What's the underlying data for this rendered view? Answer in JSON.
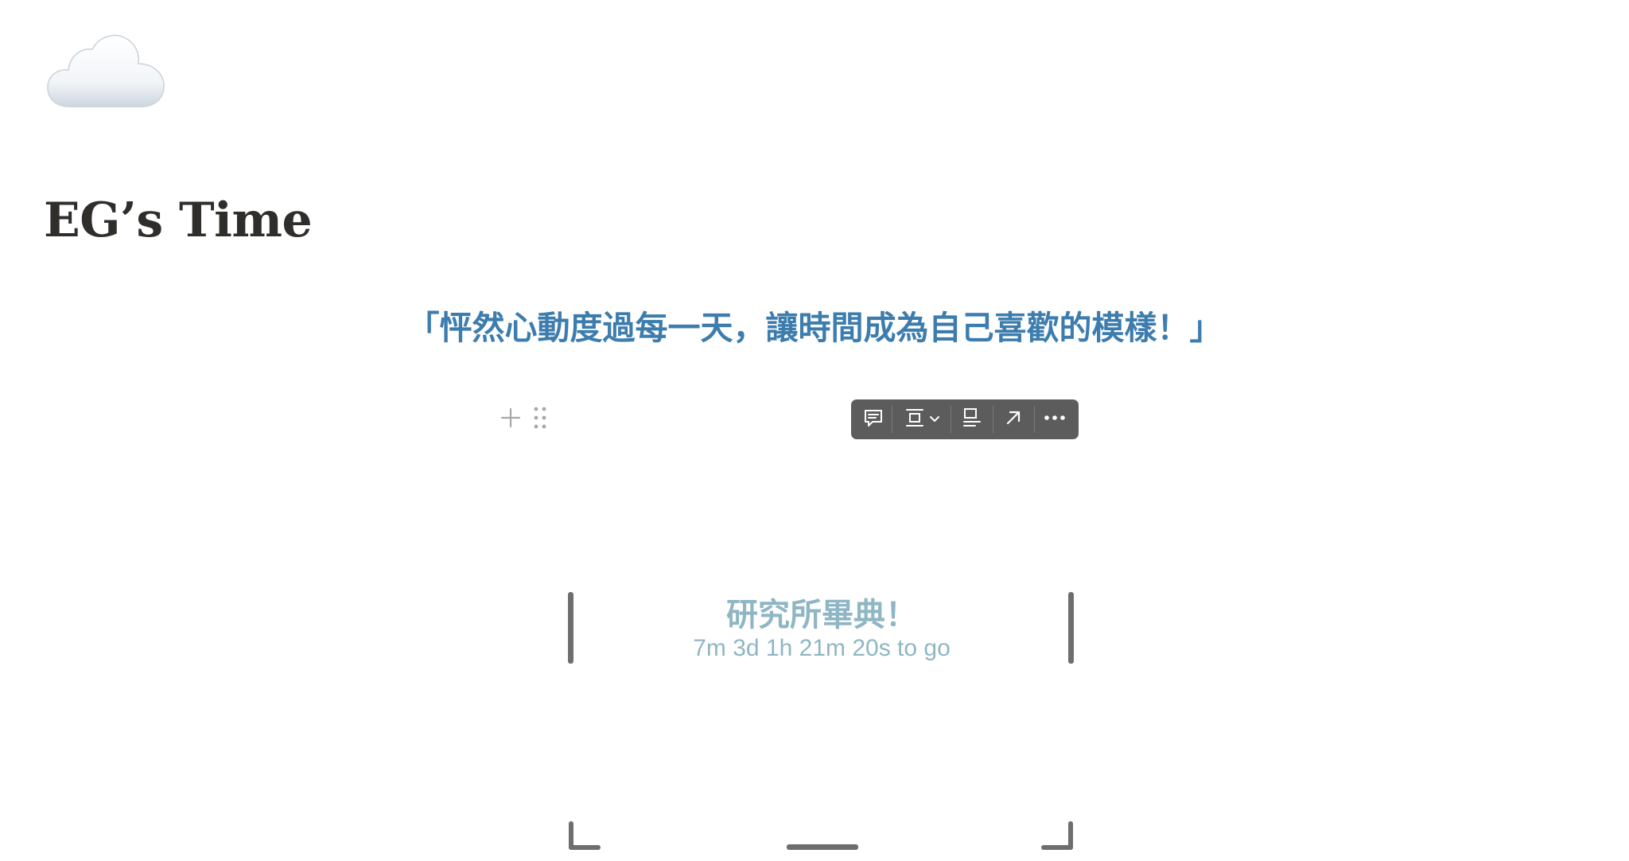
{
  "page": {
    "icon": "cloud-icon",
    "title": "EG’s Time",
    "quote": "「怦然心動度過每一天，讓時間成為自己喜歡的模樣！」"
  },
  "block_handle": {
    "add_icon": "plus-icon",
    "drag_icon": "drag-handle-icon"
  },
  "toolbar": {
    "buttons": [
      {
        "icon": "comment-icon"
      },
      {
        "icon": "align-icon"
      },
      {
        "icon": "caption-icon"
      },
      {
        "icon": "open-original-icon"
      },
      {
        "icon": "more-icon"
      }
    ]
  },
  "embed": {
    "title": "研究所畢典！",
    "countdown": "7m 3d 1h 21m 20s to go"
  },
  "colors": {
    "title": "#2f2e2b",
    "quote": "#3d7dae",
    "embed_text": "#8fb6c4",
    "toolbar_bg": "#5c5c5c",
    "resize_handle": "#6e6e6e"
  }
}
